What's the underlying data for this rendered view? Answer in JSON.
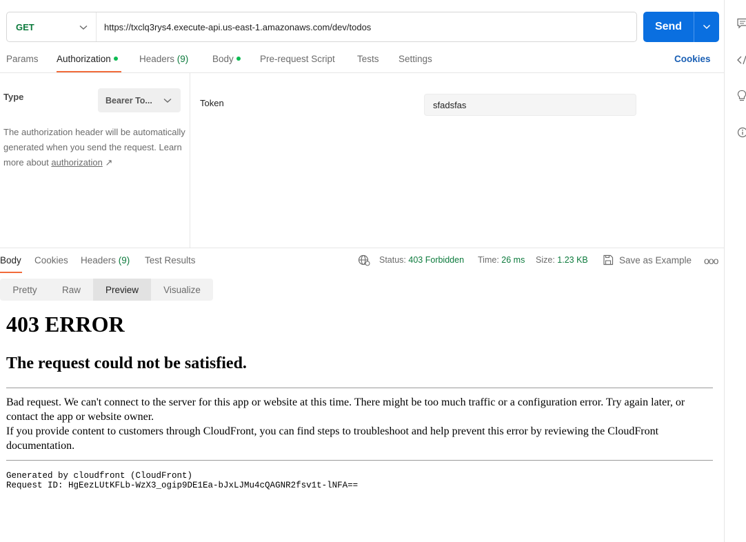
{
  "request": {
    "method": "GET",
    "url": "https://txclq3rys4.execute-api.us-east-1.amazonaws.com/dev/todos",
    "send_label": "Send"
  },
  "request_tabs": {
    "params": "Params",
    "authorization": "Authorization",
    "headers": "Headers",
    "headers_count": "(9)",
    "body": "Body",
    "pre_request": "Pre-request Script",
    "tests": "Tests",
    "settings": "Settings",
    "cookies": "Cookies"
  },
  "auth": {
    "type_label": "Type",
    "type_value": "Bearer To...",
    "description": "The authorization header will be automatically generated when you send the request. Learn more about ",
    "link_text": "authorization",
    "link_arrow": "↗",
    "token_label": "Token",
    "token_value": "sfadsfas"
  },
  "response_tabs": {
    "body": "Body",
    "cookies": "Cookies",
    "headers": "Headers",
    "headers_count": "(9)",
    "test_results": "Test Results"
  },
  "status": {
    "status_label": "Status:",
    "status_value": "403 Forbidden",
    "time_label": "Time:",
    "time_value": "26 ms",
    "size_label": "Size:",
    "size_value": "1.23 KB",
    "save_example": "Save as Example",
    "more": "ooo"
  },
  "view_modes": [
    "Pretty",
    "Raw",
    "Preview",
    "Visualize"
  ],
  "preview": {
    "h1": "403 ERROR",
    "h2": "The request could not be satisfied.",
    "p1": "Bad request. We can't connect to the server for this app or website at this time. There might be too much traffic or a configuration error. Try again later, or contact the app or website owner.",
    "p2": "If you provide content to customers through CloudFront, you can find steps to troubleshoot and help prevent this error by reviewing the CloudFront documentation.",
    "generated_by": "Generated by cloudfront (CloudFront)",
    "request_id": "Request ID: HgEezLUtKFLb-WzX3_ogip9DE1Ea-bJxLJMu4cQAGNR2fsv1t-lNFA=="
  },
  "colors": {
    "accent_blue": "#0a6fe0",
    "tab_underline": "#f26b3a",
    "success_green": "#0c7a3c",
    "dot_green": "#0cbb52"
  },
  "icons": {
    "method_dropdown": "chevron-down-icon",
    "send_dropdown": "chevron-down-icon",
    "type_dropdown": "chevron-down-icon",
    "network": "globe-icon",
    "save": "save-icon",
    "rail": [
      "comment-icon",
      "code-icon",
      "lightbulb-icon",
      "info-icon"
    ]
  }
}
